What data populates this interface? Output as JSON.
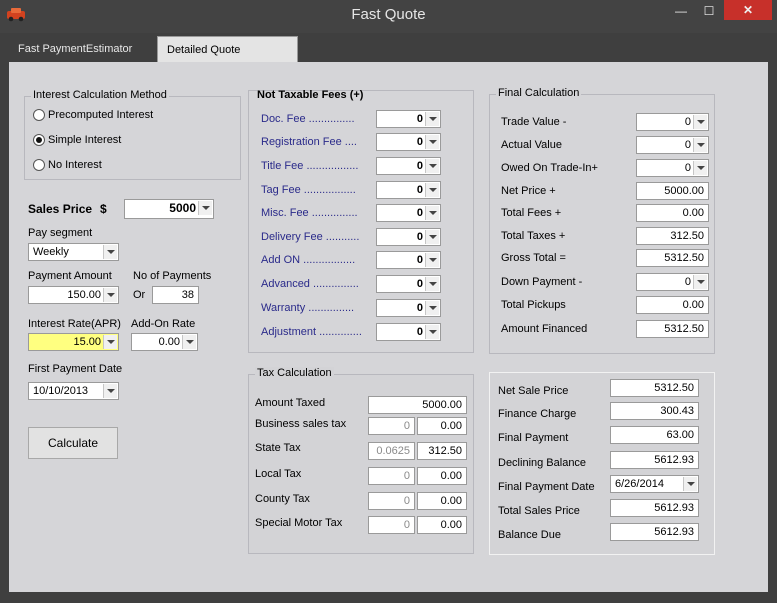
{
  "window": {
    "title": "Fast Quote",
    "min_glyph": "—",
    "max_glyph": "☐",
    "close_glyph": "✕"
  },
  "tabs": [
    {
      "label": "Fast PaymentEstimator"
    },
    {
      "label": "Detailed Quote"
    }
  ],
  "interest_method": {
    "title": "Interest Calculation Method",
    "options": [
      "Precomputed Interest",
      "Simple Interest",
      "No Interest"
    ],
    "selected": "Simple Interest"
  },
  "left": {
    "sales_price_label": "Sales Price",
    "currency_symbol": "$",
    "sales_price": "5000",
    "pay_segment_label": "Pay segment",
    "pay_segment": "Weekly",
    "payment_amount_label": "Payment Amount",
    "payment_amount": "150.00",
    "no_payments_label": "No of Payments",
    "or_label": "Or",
    "no_payments": "38",
    "interest_rate_label": "Interest Rate(APR)",
    "interest_rate": "15.00",
    "addon_rate_label": "Add-On Rate",
    "addon_rate": "0.00",
    "first_payment_label": "First Payment Date",
    "first_payment": "10/10/2013",
    "calculate_label": "Calculate"
  },
  "fees": {
    "title": "Not Taxable Fees (+)",
    "items": [
      {
        "label": "Doc. Fee ...............",
        "value": "0"
      },
      {
        "label": "Registration Fee ....",
        "value": "0"
      },
      {
        "label": "Title Fee .................",
        "value": "0"
      },
      {
        "label": "Tag Fee .................",
        "value": "0"
      },
      {
        "label": "Misc. Fee ...............",
        "value": "0"
      },
      {
        "label": "Delivery Fee ...........",
        "value": "0"
      },
      {
        "label": "Add ON .................",
        "value": "0"
      },
      {
        "label": "Advanced ...............",
        "value": "0"
      },
      {
        "label": "Warranty ...............",
        "value": "0"
      },
      {
        "label": "Adjustment ..............",
        "value": "0"
      }
    ]
  },
  "tax": {
    "title": "Tax Calculation",
    "amount_taxed_label": "Amount Taxed",
    "amount_taxed": "5000.00",
    "rows": [
      {
        "label": "Business sales tax",
        "rate": "0",
        "amount": "0.00"
      },
      {
        "label": "State Tax",
        "rate": "0.0625",
        "amount": "312.50"
      },
      {
        "label": "Local Tax",
        "rate": "0",
        "amount": "0.00"
      },
      {
        "label": "County Tax",
        "rate": "0",
        "amount": "0.00"
      },
      {
        "label": "Special Motor Tax",
        "rate": "0",
        "amount": "0.00"
      }
    ]
  },
  "final": {
    "title": "Final Calculation",
    "rows": [
      {
        "label": "Trade Value -",
        "value": "0"
      },
      {
        "label": "Actual Value",
        "value": "0"
      },
      {
        "label": "Owed On Trade-In+",
        "value": "0"
      },
      {
        "label": "Net Price +",
        "value": "5000.00"
      },
      {
        "label": "Total Fees +",
        "value": "0.00"
      },
      {
        "label": "Total Taxes +",
        "value": "312.50"
      },
      {
        "label": "Gross Total =",
        "value": "5312.50"
      },
      {
        "label": "Down Payment -",
        "value": "0"
      },
      {
        "label": "Total Pickups",
        "value": "0.00"
      },
      {
        "label": "Amount Financed",
        "value": "5312.50"
      }
    ]
  },
  "summary": {
    "rows": [
      {
        "label": "Net Sale Price",
        "value": "5312.50"
      },
      {
        "label": "Finance Charge",
        "value": "300.43"
      },
      {
        "label": "Final Payment",
        "value": "63.00"
      },
      {
        "label": "Declining Balance",
        "value": "5612.93"
      },
      {
        "label": "Final Payment Date",
        "value": "6/26/2014"
      },
      {
        "label": "Total Sales Price",
        "value": "5612.93"
      },
      {
        "label": "Balance Due",
        "value": "5612.93"
      }
    ]
  }
}
